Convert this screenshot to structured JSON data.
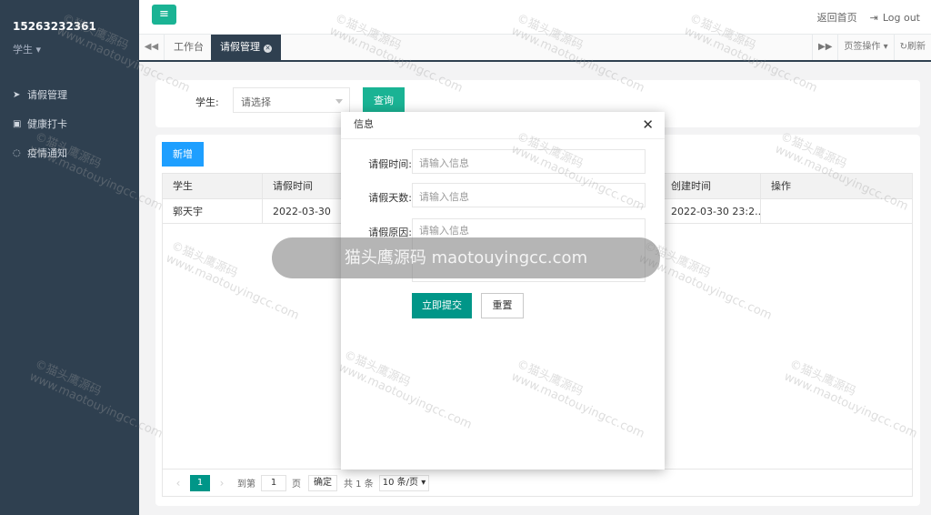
{
  "sidebar": {
    "username": "15263232361",
    "role": "学生",
    "items": [
      {
        "icon": "paper-plane-icon",
        "label": "请假管理"
      },
      {
        "icon": "calendar-icon",
        "label": "健康打卡"
      },
      {
        "icon": "chat-icon",
        "label": "疫情通知"
      }
    ]
  },
  "header": {
    "home_link": "返回首页",
    "logout": "Log out"
  },
  "tabs": {
    "items": [
      "工作台",
      "请假管理"
    ],
    "page_ops": "页签操作",
    "refresh": "刷新"
  },
  "search": {
    "label": "学生:",
    "placeholder": "请选择",
    "button": "查询"
  },
  "table": {
    "add_button": "新增",
    "headers": [
      "学生",
      "请假时间",
      "创建时间",
      "操作"
    ],
    "rows": [
      [
        "郭天宇",
        "2022-03-30",
        "2022-03-30 23:2...",
        ""
      ]
    ]
  },
  "pagination": {
    "current": "1",
    "goto_label": "到第",
    "goto_value": "1",
    "page_unit": "页",
    "confirm": "确定",
    "total": "共 1 条",
    "limit": "10 条/页"
  },
  "modal": {
    "title": "信息",
    "fields": [
      {
        "label": "请假时间:",
        "placeholder": "请输入信息"
      },
      {
        "label": "请假天数:",
        "placeholder": "请输入信息"
      },
      {
        "label": "请假原因:",
        "placeholder": "请输入信息"
      }
    ],
    "submit": "立即提交",
    "reset": "重置"
  },
  "watermark": {
    "banner": "猫头鹰源码 maotouyingcc.com",
    "tile_line1": "©猫头鹰源码",
    "tile_line2": "www.maotouyingcc.com"
  },
  "colors": {
    "sidebar": "#2f4050",
    "primary": "#1ab394",
    "blue": "#1e9fff",
    "teal": "#009688"
  }
}
